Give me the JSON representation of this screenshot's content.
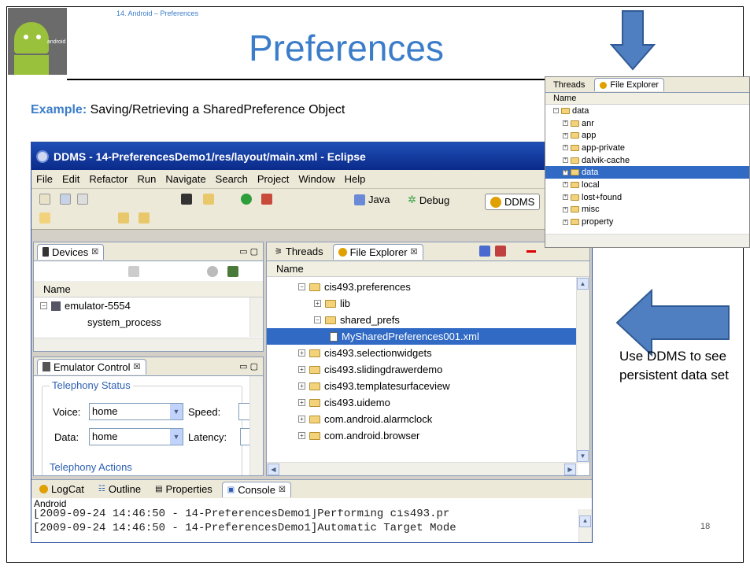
{
  "slide": {
    "header_small": "14. Android – Preferences",
    "title": "Preferences",
    "example_label": "Example:",
    "example_text": " Saving/Retrieving a SharedPreference Object",
    "side_note": "Use DDMS to see persistent data set",
    "page_number": "18",
    "logo_text": "android"
  },
  "window": {
    "title": "DDMS - 14-PreferencesDemo1/res/layout/main.xml - Eclipse",
    "menu": [
      "File",
      "Edit",
      "Refactor",
      "Run",
      "Navigate",
      "Search",
      "Project",
      "Window",
      "Help"
    ],
    "perspectives": [
      {
        "label": "Java",
        "active": false
      },
      {
        "label": "Debug",
        "active": false
      },
      {
        "label": "DDMS",
        "active": true
      }
    ]
  },
  "devices": {
    "tab_label": "Devices",
    "column": "Name",
    "rows": [
      {
        "label": "emulator-5554",
        "indent": 0,
        "expander": "⊟"
      },
      {
        "label": "system_process",
        "indent": 1,
        "expander": ""
      }
    ]
  },
  "emulator_control": {
    "tab_label": "Emulator Control",
    "group_label": "Telephony Status",
    "voice_label": "Voice:",
    "voice_value": "home",
    "speed_label": "Speed:",
    "data_label": "Data:",
    "data_value": "home",
    "latency_label": "Latency:",
    "actions_label": "Telephony Actions"
  },
  "file_explorer": {
    "tabs": [
      "Threads",
      "File Explorer"
    ],
    "column": "Name",
    "rows": [
      {
        "label": "cis493.preferences",
        "level": 1,
        "exp": "⊟",
        "type": "folder",
        "selected": false
      },
      {
        "label": "lib",
        "level": 2,
        "exp": "⊞",
        "type": "folder",
        "selected": false
      },
      {
        "label": "shared_prefs",
        "level": 2,
        "exp": "⊟",
        "type": "folder",
        "selected": false
      },
      {
        "label": "MySharedPreferences001.xml",
        "level": 3,
        "exp": "",
        "type": "file",
        "selected": true
      },
      {
        "label": "cis493.selectionwidgets",
        "level": 1,
        "exp": "⊞",
        "type": "folder",
        "selected": false
      },
      {
        "label": "cis493.slidingdrawerdemo",
        "level": 1,
        "exp": "⊞",
        "type": "folder",
        "selected": false
      },
      {
        "label": "cis493.templatesurfaceview",
        "level": 1,
        "exp": "⊞",
        "type": "folder",
        "selected": false
      },
      {
        "label": "cis493.uidemo",
        "level": 1,
        "exp": "⊞",
        "type": "folder",
        "selected": false
      },
      {
        "label": "com.android.alarmclock",
        "level": 1,
        "exp": "⊞",
        "type": "folder",
        "selected": false
      },
      {
        "label": "com.android.browser",
        "level": 1,
        "exp": "⊞",
        "type": "folder",
        "selected": false
      }
    ]
  },
  "bottom": {
    "tabs": [
      "LogCat",
      "Outline",
      "Properties",
      "Console"
    ],
    "console_title": "Android",
    "lines": [
      "[2009-09-24 14:46:50 - 14-PreferencesDemo1]Performing cis493.pr",
      "[2009-09-24 14:46:50 - 14-PreferencesDemo1]Automatic Target Mode"
    ]
  },
  "overlay_explorer": {
    "tabs": [
      "Threads",
      "File Explorer"
    ],
    "column": "Name",
    "rows": [
      {
        "label": "data",
        "level": 0,
        "exp": "⊟",
        "selected": false
      },
      {
        "label": "anr",
        "level": 1,
        "exp": "⊞",
        "selected": false
      },
      {
        "label": "app",
        "level": 1,
        "exp": "⊞",
        "selected": false
      },
      {
        "label": "app-private",
        "level": 1,
        "exp": "⊞",
        "selected": false
      },
      {
        "label": "dalvik-cache",
        "level": 1,
        "exp": "⊞",
        "selected": false
      },
      {
        "label": "data",
        "level": 1,
        "exp": "⊞",
        "selected": true
      },
      {
        "label": "local",
        "level": 1,
        "exp": "⊞",
        "selected": false
      },
      {
        "label": "lost+found",
        "level": 1,
        "exp": "⊞",
        "selected": false
      },
      {
        "label": "misc",
        "level": 1,
        "exp": "⊞",
        "selected": false
      },
      {
        "label": "property",
        "level": 1,
        "exp": "⊞",
        "selected": false
      }
    ]
  },
  "colors": {
    "accent": "#3b7dc9",
    "arrow": "#4f7fc0",
    "selection": "#316ac5"
  }
}
